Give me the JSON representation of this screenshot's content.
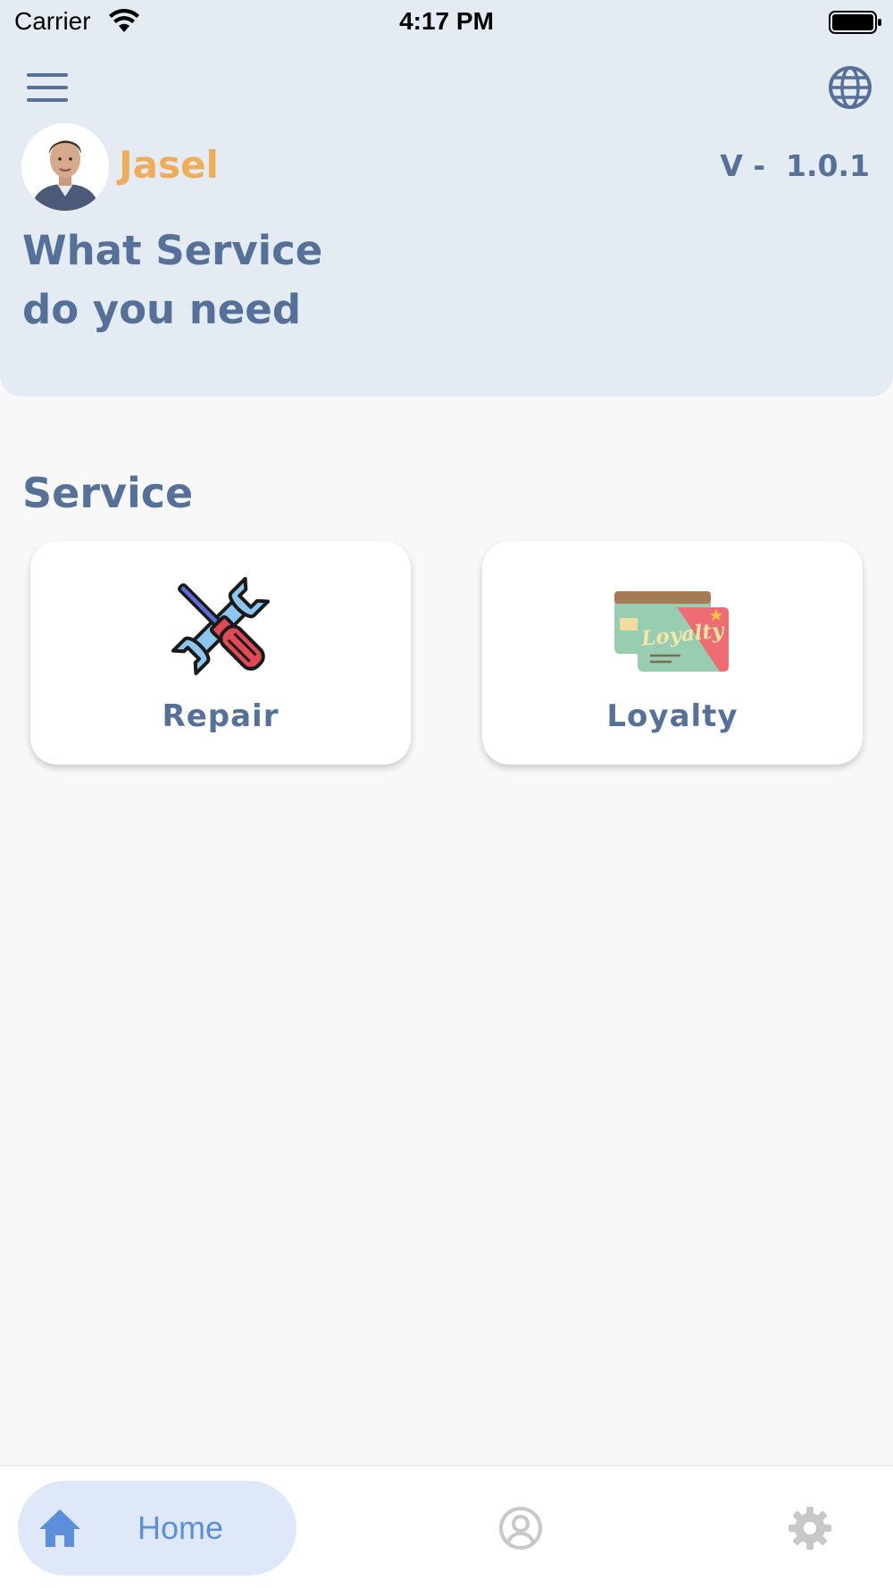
{
  "status_bar": {
    "carrier": "Carrier",
    "time": "4:17 PM"
  },
  "header": {
    "menu_icon": "hamburger-menu-icon",
    "language_icon": "globe-icon",
    "user_name": "Jasel",
    "version": "V -  1.0.1",
    "headline_line1": "What Service",
    "headline_line2": "do you need"
  },
  "services": {
    "section_title": "Service",
    "items": [
      {
        "label": "Repair",
        "icon": "repair-tools-icon"
      },
      {
        "label": "Loyalty",
        "icon": "loyalty-card-icon",
        "icon_text": "Loyalty"
      }
    ]
  },
  "bottom_nav": {
    "items": [
      {
        "label": "Home",
        "icon": "home-icon",
        "active": true
      },
      {
        "label": "",
        "icon": "profile-icon",
        "active": false
      },
      {
        "label": "",
        "icon": "settings-icon",
        "active": false
      }
    ]
  },
  "colors": {
    "accent": "#557099",
    "name": "#f0ad59",
    "header_bg": "#e5ebf2",
    "nav_active_bg": "#dfe8f8",
    "nav_active_fg": "#5b8fd9",
    "nav_inactive": "#c8c8c8"
  }
}
